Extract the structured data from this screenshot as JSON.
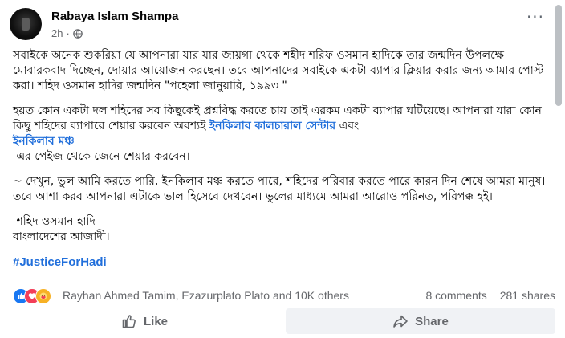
{
  "post": {
    "author": "Rabaya Islam Shampa",
    "time": "2h",
    "paragraphs": [
      "সবাইকে অনেক শুকরিয়া যে আপনারা যার যার জায়গা থেকে শহীদ শরিফ ওসমান হাদিকে তার জন্মদিন উপলক্ষে মোবারকবাদ দিচ্ছেন, দোয়ার আয়োজন করছেন। তবে আপনাদের সবাইকে একটা ব্যাপার ক্লিয়ার করার জন্য আমার পোস্ট করা। শহিদ ওসমান হাদির জন্মদিন \"পহেলা জানুয়ারি, ১৯৯৩ \"",
      "~ দেখুন, ভুল আমি করতে পারি, ইনকিলাব মঞ্চ করতে পারে, শহিদের পরিবার করতে পারে কারন দিন শেষে আমরা মানুষ। তবে আশা করব আপনারা এটাকে ভাল হিসেবে দেখবেন। ভুলের মাধ্যমে আমরা আরোও পরিনত, পরিপক্ক হই।"
    ],
    "para2_text": "হয়ত কোন একটা দল শহিদের সব কিছুকেই প্রশ্নবিদ্ধ করতে চায় তাই এরকম একটা ব্যাপার ঘটিয়েছে। আপনারা যারা কোন কিছু শহিদের ব্যাপারে শেয়ার করবেন অবশ্যই ",
    "link1": "ইনকিলাব কালচারাল সেন্টার",
    "and_text": " এবং ",
    "link2": "ইনকিলাব মঞ্চ",
    "para2_end": " এর পেইজ থেকে জেনে শেয়ার করবেন।",
    "sign_line1": " শহিদ ওসমান হাদি",
    "sign_line2": "বাংলাদেশের আজাদী।",
    "hashtag": "#JusticeForHadi"
  },
  "reactions": {
    "names": "Rayhan Ahmed Tamim, Ezazurplato Plato and 10K others",
    "comments": "8 comments",
    "shares": "281 shares"
  },
  "actions": {
    "like": "Like",
    "share": "Share"
  },
  "colors": {
    "link": "#216fdb",
    "like_blue": "#1877f2",
    "love_red": "#f33e58",
    "care_yellow": "#f7b125"
  }
}
